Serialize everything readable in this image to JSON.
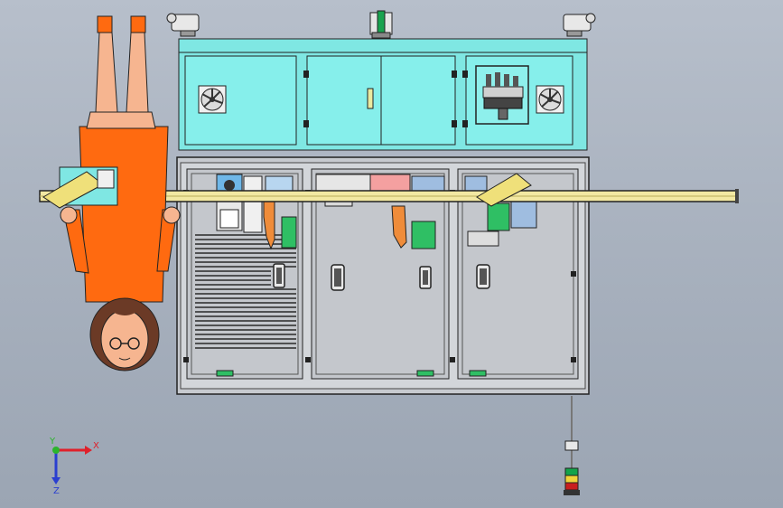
{
  "viewport": {
    "background_top": "#b7bfcb",
    "background_bottom": "#9ba5b3"
  },
  "triad": {
    "x_label": "X",
    "y_label": "Y",
    "z_label": "Z",
    "x_color": "#e0202a",
    "y_color": "#2bb52b",
    "z_color": "#2a3fd0"
  },
  "colors": {
    "cabinet_top": "#7fe7e3",
    "cabinet_outline": "#222222",
    "frame_gray": "#c9ccd0",
    "conveyor_yellow": "#f2e8a2",
    "operator_shirt": "#ff6a10",
    "operator_skin": "#f6b590",
    "operator_hair": "#6b3a26",
    "warning_green": "#14a34a",
    "warning_red": "#c81e1e",
    "warning_yellow": "#f0d43a"
  },
  "components": {
    "stack_light": "tower-lamp",
    "fans": [
      "fan-icon",
      "fan-icon"
    ],
    "camera_heads": [
      "camera-icon",
      "camera-icon"
    ]
  }
}
